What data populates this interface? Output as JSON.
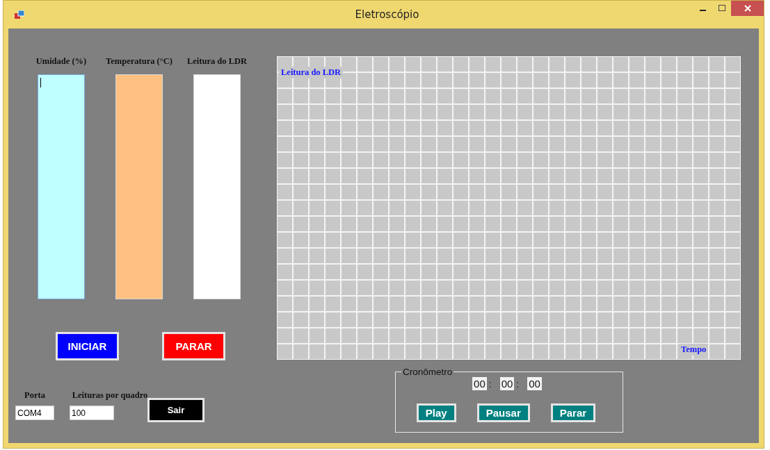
{
  "window": {
    "title": "Eletroscópio"
  },
  "gauges": [
    {
      "label": "Umidade (%)",
      "color": "#c0ffff",
      "focused": true
    },
    {
      "label": "Temperatura (°C)",
      "color": "#ffc080",
      "focused": false
    },
    {
      "label": "Leitura do LDR",
      "color": "#ffffff",
      "focused": false
    }
  ],
  "actions": [
    {
      "label": "INICIAR",
      "color": "#0000ff"
    },
    {
      "label": "PARAR",
      "color": "#ff0000"
    }
  ],
  "port": {
    "label": "Porta",
    "value": "COM4"
  },
  "readings": {
    "label": "Leituras por quadro",
    "value": "100"
  },
  "exit_button": "Sair",
  "graph": {
    "y_label": "Leitura do LDR",
    "x_label": "Tempo"
  },
  "stopwatch": {
    "title": "Cronômetro",
    "fields": [
      "00",
      "00",
      "00"
    ],
    "separator": ":",
    "buttons": [
      "Play",
      "Pausar",
      "Parar"
    ]
  }
}
